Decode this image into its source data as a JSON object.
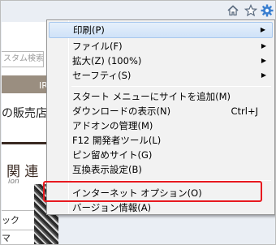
{
  "chrome": {
    "home_icon": "home-icon",
    "favorites_icon": "star-icon",
    "tools_icon": "gear-icon",
    "accent": "#3a7fd0"
  },
  "background_page": {
    "search_placeholder": "スタム検索",
    "band_text": "IR 情",
    "heading": "の販売店",
    "section_title": "関 連",
    "section_subtitle": "ion",
    "link1": "ック",
    "link2": "マ"
  },
  "menu": {
    "items": [
      {
        "label": "印刷(P)",
        "arrow": "▶"
      },
      {
        "label": "ファイル(F)",
        "arrow": "▶"
      },
      {
        "label": "拡大(Z) (100%)",
        "arrow": "▶"
      },
      {
        "label": "セーフティ(S)",
        "arrow": "▶"
      },
      {
        "label": "スタート メニューにサイトを追加(M)"
      },
      {
        "label": "ダウンロードの表示(N)",
        "shortcut": "Ctrl+J"
      },
      {
        "label": "アドオンの管理(M)"
      },
      {
        "label": "F12 開発者ツール(L)"
      },
      {
        "label": "ピン留めサイト(G)"
      },
      {
        "label": "互換表示設定(B)"
      },
      {
        "label": "インターネット オプション(O)"
      },
      {
        "label": "バージョン情報(A)"
      }
    ],
    "highlight_color": "#e8191f"
  }
}
